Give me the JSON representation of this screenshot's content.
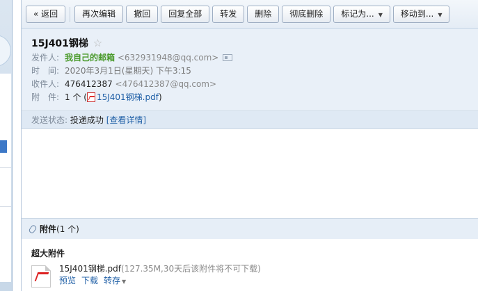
{
  "toolbar": {
    "back": "« 返回",
    "reedit": "再次编辑",
    "recall": "撤回",
    "reply_all": "回复全部",
    "forward": "转发",
    "delete": "删除",
    "delete_permanent": "彻底删除",
    "mark_as": "标记为...",
    "move_to": "移动到..."
  },
  "mail": {
    "subject": "15J401钢梯",
    "star": "☆",
    "sender_label": "发件人:",
    "sender_name": "我自己的邮箱",
    "sender_email": "<632931948@qq.com>",
    "time_label": "时　间:",
    "time_value": "2020年3月1日(星期天) 下午3:15",
    "recipient_label": "收件人:",
    "recipient_name": "476412387",
    "recipient_email": "<476412387@qq.com>",
    "attach_label": "附　件:",
    "attach_count": "1 个 (",
    "attach_file": "15J401钢梯.pdf",
    "attach_close": ")"
  },
  "status": {
    "label": "发送状态:",
    "value": "投递成功",
    "details": "[查看详情]"
  },
  "attachments": {
    "title": "附件",
    "count": "(1 个)",
    "section_title": "超大附件",
    "file_name": "15J401钢梯.pdf",
    "file_meta": "(127.35M,30天后该附件将不可下载)",
    "preview": "预览",
    "download": "下载",
    "save": "转存"
  }
}
